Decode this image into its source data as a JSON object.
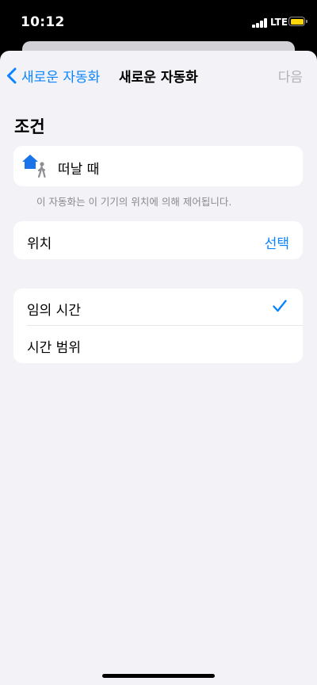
{
  "status_bar": {
    "time": "10:12",
    "network": "LTE",
    "battery_color": "#ffd60a"
  },
  "nav": {
    "back_label": "새로운 자동화",
    "title": "새로운 자동화",
    "next_label": "다음"
  },
  "condition": {
    "section_title": "조건",
    "trigger_label": "떠날 때",
    "trigger_icon": "home-leaving-icon",
    "footnote": "이 자동화는 이 기기의 위치에 의해 제어됩니다."
  },
  "location": {
    "label": "위치",
    "action_label": "선택"
  },
  "time_options": [
    {
      "label": "임의 시간",
      "selected": true
    },
    {
      "label": "시간 범위",
      "selected": false
    }
  ],
  "colors": {
    "accent": "#0a84ff",
    "background": "#f2f2f7",
    "disabled": "#b2b2b7"
  }
}
